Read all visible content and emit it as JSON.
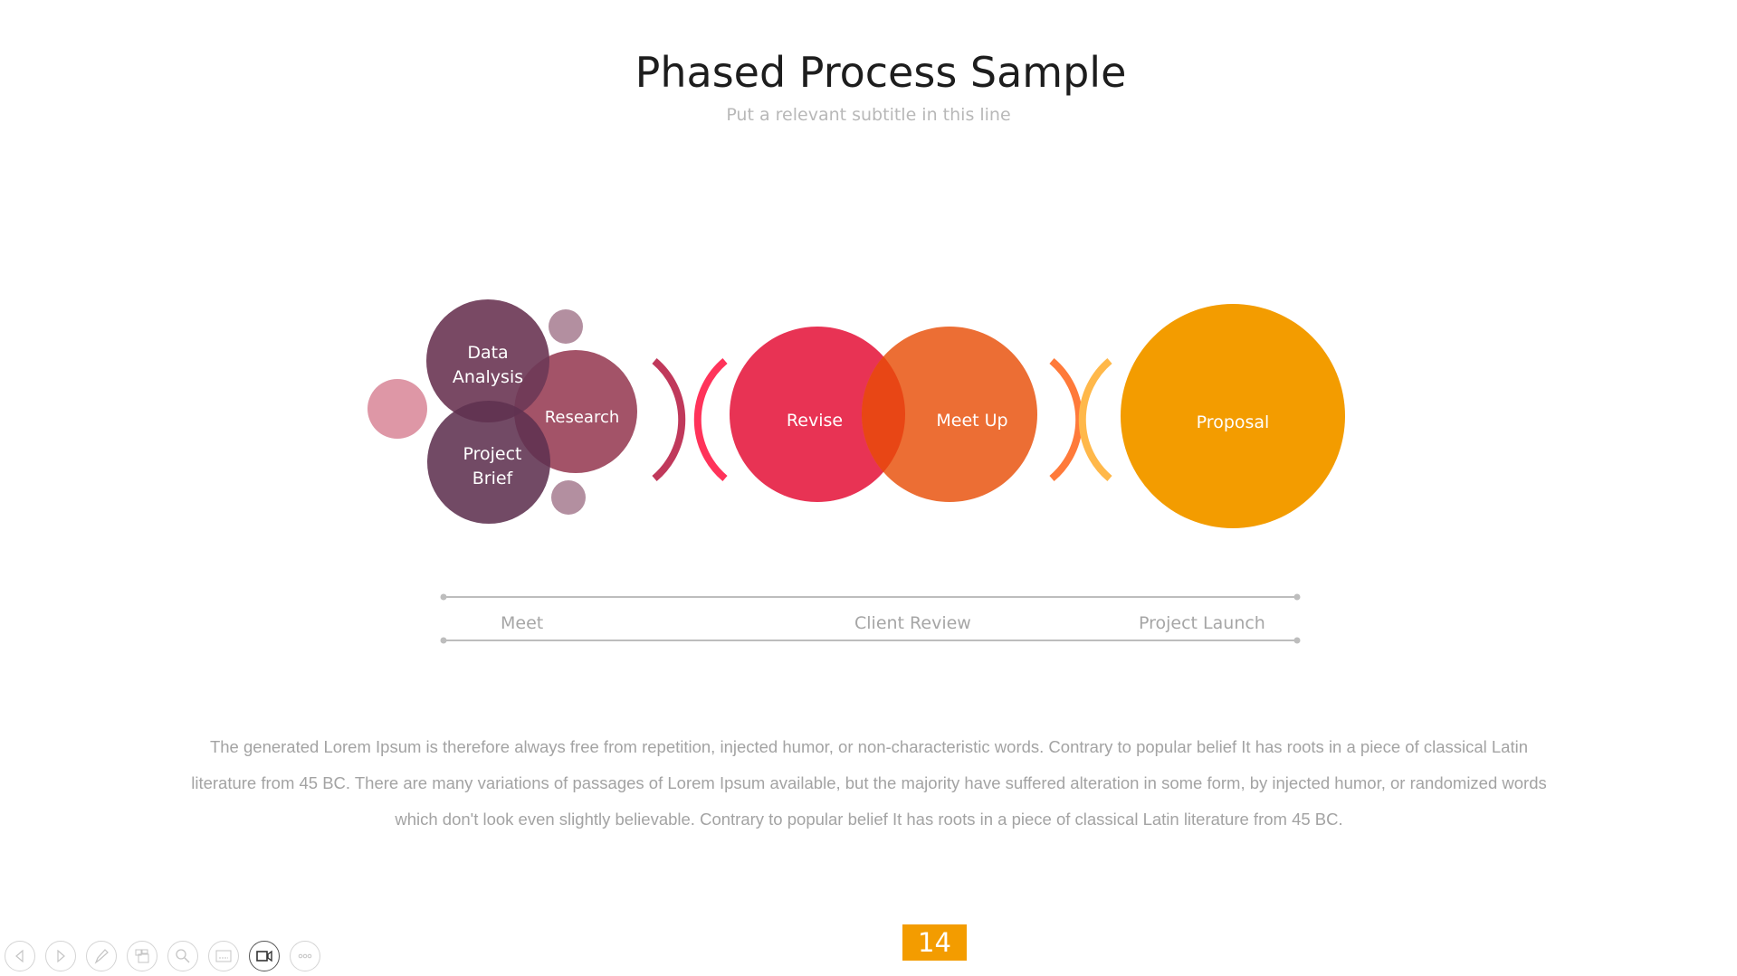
{
  "slide": {
    "title": "Phased Process Sample",
    "subtitle": "Put a relevant subtitle in this line",
    "page_number": "14"
  },
  "diagram": {
    "circles": [
      {
        "id": "data-analysis",
        "label_lines": [
          "Data",
          "Analysis"
        ],
        "color": "#6E3A57"
      },
      {
        "id": "research",
        "label_lines": [
          "Research"
        ],
        "color": "#9C4560"
      },
      {
        "id": "project-brief",
        "label_lines": [
          "Project",
          "Brief"
        ],
        "color": "#5F3150"
      },
      {
        "id": "revise",
        "label_lines": [
          "Revise"
        ],
        "color": "#E83354"
      },
      {
        "id": "meet-up",
        "label_lines": [
          "Meet Up"
        ],
        "color": "#EC6E34"
      },
      {
        "id": "proposal",
        "label_lines": [
          "Proposal"
        ],
        "color": "#F39C00"
      }
    ],
    "decor_colors": {
      "pink_dot": "#DE97A6",
      "mauve_dot": "#B38FA0",
      "arc_1": "#C0395B",
      "arc_2": "#FF335A",
      "arc_3": "#FF7A3A",
      "arc_4": "#FFB84A",
      "overlap_revise_meetup": "#E84615",
      "overlap_dark": "#5A2542"
    }
  },
  "timeline": {
    "labels": [
      "Meet",
      "Client Review",
      "Project Launch"
    ],
    "line_color": "#bdbdbd"
  },
  "body": {
    "line1": "The generated Lorem Ipsum is therefore always free from repetition, injected humor, or non-characteristic words. Contrary to popular belief It has roots in a piece of classical Latin",
    "line2": "literature from 45 BC. There are many variations of passages of Lorem Ipsum available, but the majority have suffered alteration in some form, by injected humor, or randomized words",
    "line3": "which don't look even slightly believable. Contrary to popular belief It has roots in a piece of classical Latin literature from 45 BC."
  },
  "toolbar": {
    "buttons": [
      {
        "icon": "previous-icon",
        "active": false
      },
      {
        "icon": "next-icon",
        "active": false
      },
      {
        "icon": "pen-icon",
        "active": false
      },
      {
        "icon": "slides-grid-icon",
        "active": false
      },
      {
        "icon": "zoom-icon",
        "active": false
      },
      {
        "icon": "subtitles-icon",
        "active": false
      },
      {
        "icon": "camera-icon",
        "active": true
      },
      {
        "icon": "more-icon",
        "active": false
      }
    ]
  }
}
